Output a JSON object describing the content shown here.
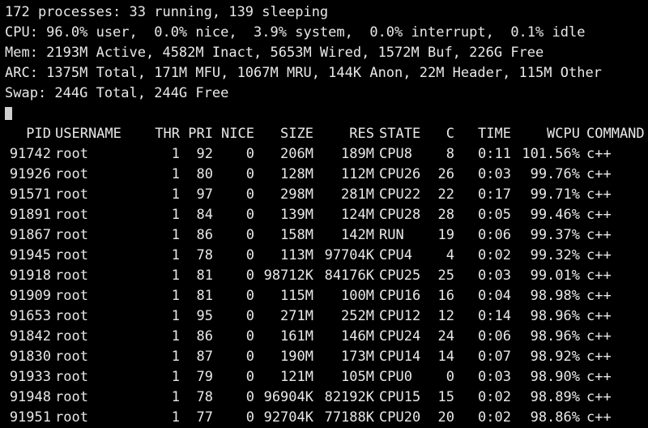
{
  "terminal": {
    "summary": [
      "172 processes: 33 running, 139 sleeping",
      "CPU: 96.0% user,  0.0% nice,  3.9% system,  0.0% interrupt,  0.1% idle",
      "Mem: 2193M Active, 4582M Inact, 5653M Wired, 1572M Buf, 226G Free",
      "ARC: 1375M Total, 171M MFU, 1067M MRU, 144K Anon, 22M Header, 115M Other",
      "Swap: 244G Total, 244G Free"
    ],
    "header": {
      "pid": "PID",
      "username": "USERNAME",
      "thr": "THR",
      "pri": "PRI",
      "nice": "NICE",
      "size": "SIZE",
      "res": "RES",
      "state": "STATE",
      "c": "C",
      "time": "TIME",
      "wcpu": "WCPU",
      "command": "COMMAND"
    },
    "processes": [
      {
        "pid": "91742",
        "username": "root",
        "thr": "1",
        "pri": "92",
        "nice": "0",
        "size": "206M",
        "res": "189M",
        "state": "CPU8",
        "c": "8",
        "time": "0:11",
        "wcpu": "101.56%",
        "command": "c++"
      },
      {
        "pid": "91926",
        "username": "root",
        "thr": "1",
        "pri": "80",
        "nice": "0",
        "size": "128M",
        "res": "112M",
        "state": "CPU26",
        "c": "26",
        "time": "0:03",
        "wcpu": "99.76%",
        "command": "c++"
      },
      {
        "pid": "91571",
        "username": "root",
        "thr": "1",
        "pri": "97",
        "nice": "0",
        "size": "298M",
        "res": "281M",
        "state": "CPU22",
        "c": "22",
        "time": "0:17",
        "wcpu": "99.71%",
        "command": "c++"
      },
      {
        "pid": "91891",
        "username": "root",
        "thr": "1",
        "pri": "84",
        "nice": "0",
        "size": "139M",
        "res": "124M",
        "state": "CPU28",
        "c": "28",
        "time": "0:05",
        "wcpu": "99.46%",
        "command": "c++"
      },
      {
        "pid": "91867",
        "username": "root",
        "thr": "1",
        "pri": "86",
        "nice": "0",
        "size": "158M",
        "res": "142M",
        "state": "RUN",
        "c": "19",
        "time": "0:06",
        "wcpu": "99.37%",
        "command": "c++"
      },
      {
        "pid": "91945",
        "username": "root",
        "thr": "1",
        "pri": "78",
        "nice": "0",
        "size": "113M",
        "res": "97704K",
        "state": "CPU4",
        "c": "4",
        "time": "0:02",
        "wcpu": "99.32%",
        "command": "c++"
      },
      {
        "pid": "91918",
        "username": "root",
        "thr": "1",
        "pri": "81",
        "nice": "0",
        "size": "98712K",
        "res": "84176K",
        "state": "CPU25",
        "c": "25",
        "time": "0:03",
        "wcpu": "99.01%",
        "command": "c++"
      },
      {
        "pid": "91909",
        "username": "root",
        "thr": "1",
        "pri": "81",
        "nice": "0",
        "size": "115M",
        "res": "100M",
        "state": "CPU16",
        "c": "16",
        "time": "0:04",
        "wcpu": "98.98%",
        "command": "c++"
      },
      {
        "pid": "91653",
        "username": "root",
        "thr": "1",
        "pri": "95",
        "nice": "0",
        "size": "271M",
        "res": "252M",
        "state": "CPU12",
        "c": "12",
        "time": "0:14",
        "wcpu": "98.96%",
        "command": "c++"
      },
      {
        "pid": "91842",
        "username": "root",
        "thr": "1",
        "pri": "86",
        "nice": "0",
        "size": "161M",
        "res": "146M",
        "state": "CPU24",
        "c": "24",
        "time": "0:06",
        "wcpu": "98.96%",
        "command": "c++"
      },
      {
        "pid": "91830",
        "username": "root",
        "thr": "1",
        "pri": "87",
        "nice": "0",
        "size": "190M",
        "res": "173M",
        "state": "CPU14",
        "c": "14",
        "time": "0:07",
        "wcpu": "98.92%",
        "command": "c++"
      },
      {
        "pid": "91933",
        "username": "root",
        "thr": "1",
        "pri": "79",
        "nice": "0",
        "size": "121M",
        "res": "105M",
        "state": "CPU0",
        "c": "0",
        "time": "0:03",
        "wcpu": "98.90%",
        "command": "c++"
      },
      {
        "pid": "91948",
        "username": "root",
        "thr": "1",
        "pri": "78",
        "nice": "0",
        "size": "96904K",
        "res": "82192K",
        "state": "CPU15",
        "c": "15",
        "time": "0:02",
        "wcpu": "98.89%",
        "command": "c++"
      },
      {
        "pid": "91951",
        "username": "root",
        "thr": "1",
        "pri": "77",
        "nice": "0",
        "size": "92704K",
        "res": "77188K",
        "state": "CPU20",
        "c": "20",
        "time": "0:02",
        "wcpu": "98.86%",
        "command": "c++"
      }
    ]
  }
}
